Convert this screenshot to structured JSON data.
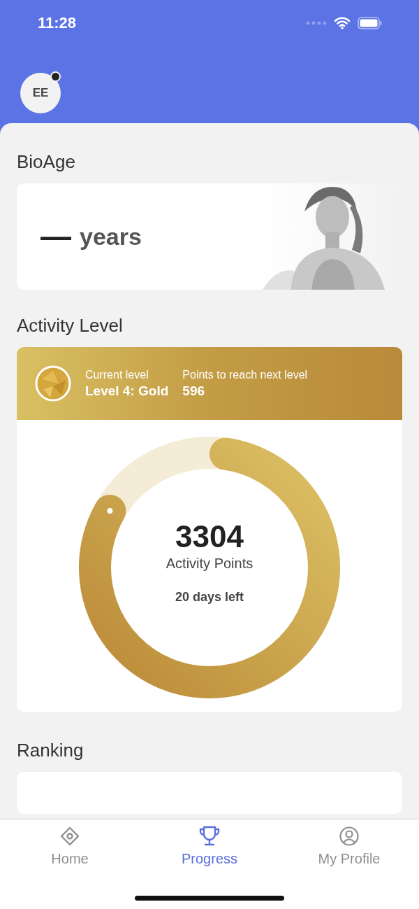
{
  "status_bar": {
    "time": "11:28"
  },
  "header": {
    "avatar_initials": "EE",
    "notification": true
  },
  "bioage": {
    "title": "BioAge",
    "value": "—",
    "unit": "years"
  },
  "activity": {
    "title": "Activity Level",
    "current_label": "Current level",
    "current_value": "Level 4: Gold",
    "next_label": "Points to reach next level",
    "next_value": "596",
    "points": "3304",
    "points_label": "Activity Points",
    "days_left": "20 days left"
  },
  "ranking": {
    "title": "Ranking"
  },
  "tabs": [
    {
      "label": "Home",
      "kind": "home",
      "selected": false
    },
    {
      "label": "Progress",
      "kind": "progress",
      "selected": true
    },
    {
      "label": "My Profile",
      "kind": "profile",
      "selected": false
    }
  ]
}
